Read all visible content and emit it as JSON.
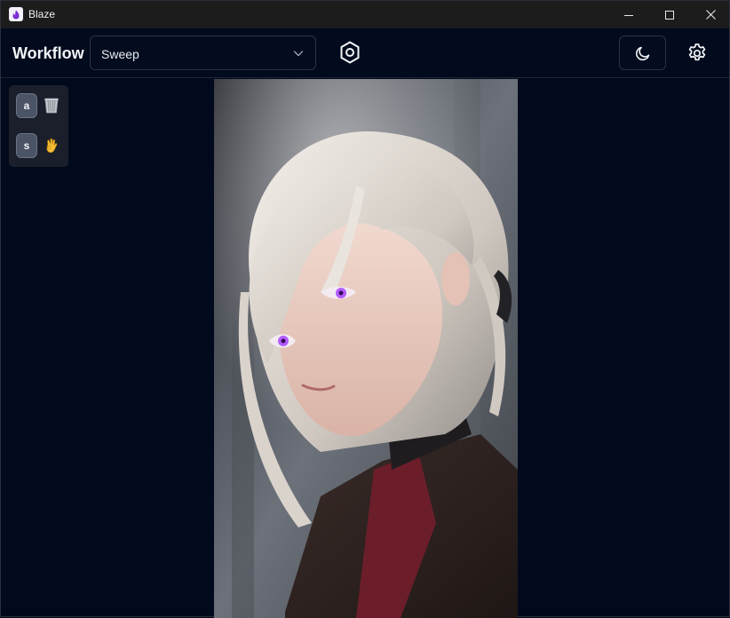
{
  "window": {
    "title": "Blaze"
  },
  "header": {
    "label": "Workflow",
    "workflow_select": {
      "value": "Sweep"
    }
  },
  "shortcuts": [
    {
      "key": "a",
      "icon": "trash-basket-icon"
    },
    {
      "key": "s",
      "icon": "ok-hand-icon"
    }
  ],
  "colors": {
    "background": "#010a1c",
    "titlebar": "#1c1c1c",
    "panel": "#1a1f2b",
    "accent_eye": "#b35cff"
  },
  "image": {
    "subject": "portrait-illustration"
  }
}
